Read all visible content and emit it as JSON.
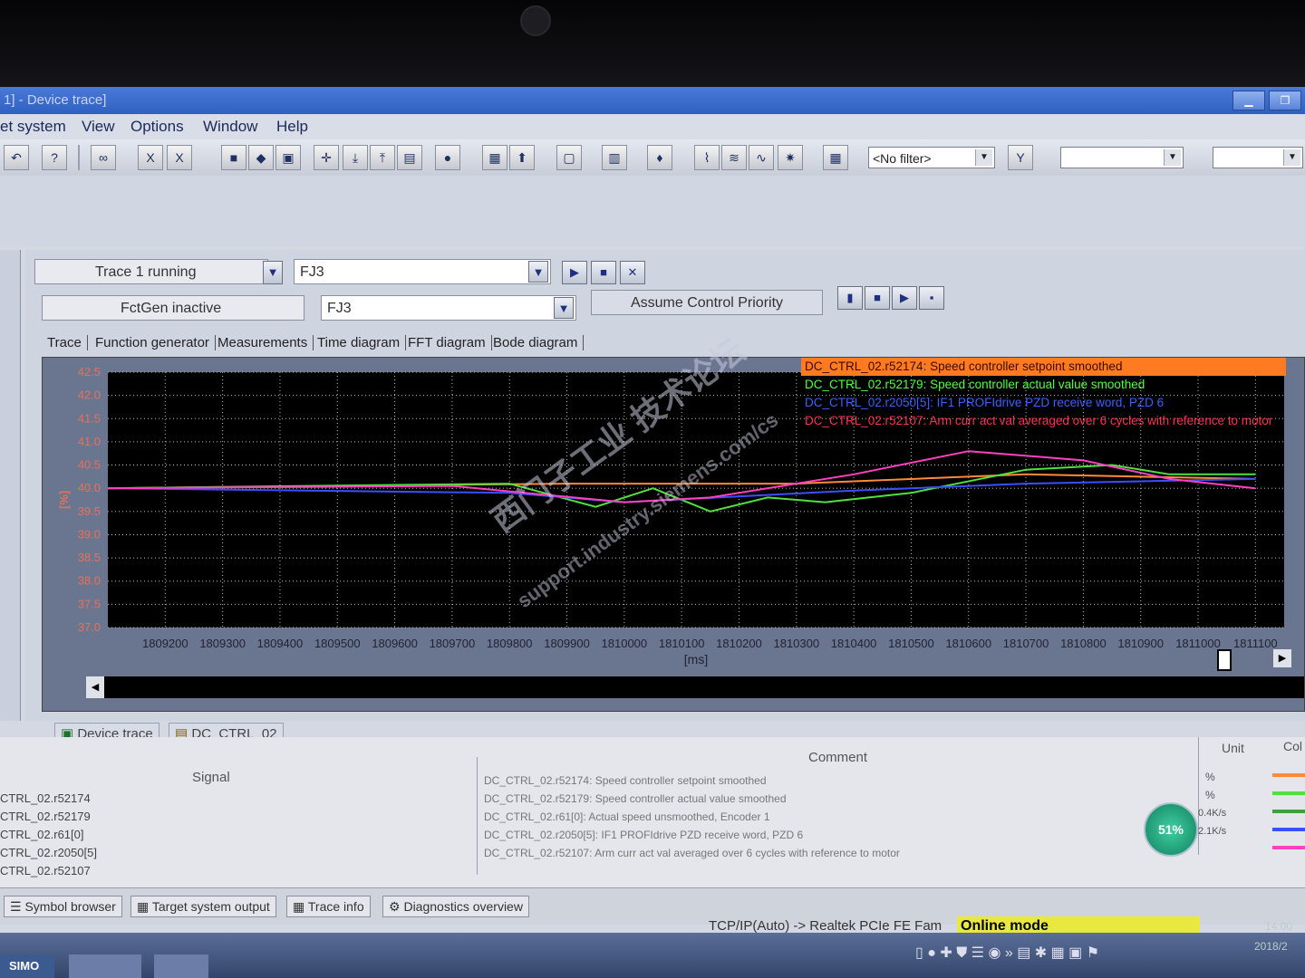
{
  "window": {
    "title": "1] - Device trace]",
    "min": "▁",
    "max": "❐"
  },
  "menu": [
    "et system",
    "View",
    "Options",
    "Window",
    "Help"
  ],
  "toolbar": {
    "filter_value": "<No filter>"
  },
  "trace_controls": {
    "trace_status": "Trace 1 running",
    "trace_drive": "FJ3",
    "fctgen_status": "FctGen  inactive",
    "fctgen_drive": "FJ3",
    "assume_priority": "Assume Control Priority"
  },
  "tabs": [
    "Trace",
    "Function generator",
    "Measurements",
    "Time diagram",
    "FFT diagram",
    "Bode diagram"
  ],
  "chart_data": {
    "type": "line",
    "ylabel": "[%]",
    "xlabel": "[ms]",
    "yticks": [
      "42.5",
      "42.0",
      "41.5",
      "41.0",
      "40.5",
      "40.0",
      "39.5",
      "39.0",
      "38.5",
      "38.0",
      "37.5",
      "37.0"
    ],
    "xticks": [
      "1809200",
      "1809300",
      "1809400",
      "1809500",
      "1809600",
      "1809700",
      "1809800",
      "1809900",
      "1810000",
      "1810100",
      "1810200",
      "1810300",
      "1810400",
      "1810500",
      "1810600",
      "1810700",
      "1810800",
      "1810900",
      "1811000",
      "1811100"
    ],
    "ylim": [
      37.0,
      42.5
    ],
    "series": [
      {
        "name": "DC_CTRL_02.r52174: Speed controller setpoint smoothed",
        "color": "#ff8a3a",
        "x": [
          1809100,
          1809500,
          1809900,
          1810300,
          1810700,
          1811100
        ],
        "y": [
          40.0,
          40.05,
          40.1,
          40.1,
          40.3,
          40.2
        ]
      },
      {
        "name": "DC_CTRL_02.r52179: Speed controller actual value smoothed",
        "color": "#50e040",
        "x": [
          1809100,
          1809800,
          1809950,
          1810050,
          1810150,
          1810250,
          1810350,
          1810500,
          1810700,
          1810850,
          1810950,
          1811100
        ],
        "y": [
          40.0,
          40.1,
          39.6,
          40.0,
          39.5,
          39.8,
          39.7,
          39.9,
          40.4,
          40.5,
          40.3,
          40.3
        ]
      },
      {
        "name": "DC_CTRL_02.r2050[5]: IF1 PROFIdrive PZD receive word, PZD 6",
        "color": "#3a50ff",
        "x": [
          1809100,
          1809800,
          1810000,
          1810400,
          1810700,
          1811100
        ],
        "y": [
          40.0,
          39.9,
          39.7,
          39.95,
          40.1,
          40.2
        ]
      },
      {
        "name": "DC_CTRL_02.r52107: Arm curr act val averaged over 6 cycles with reference to motor",
        "color": "#ff40c0",
        "x": [
          1809100,
          1809700,
          1810000,
          1810150,
          1810400,
          1810600,
          1810800,
          1810950,
          1811100
        ],
        "y": [
          40.0,
          40.05,
          39.7,
          39.8,
          40.3,
          40.8,
          40.6,
          40.2,
          40.0
        ]
      }
    ]
  },
  "bottom_tabs": [
    "Device trace",
    "DC_CTRL_02"
  ],
  "signal_table": {
    "headers": {
      "signal": "Signal",
      "comment": "Comment",
      "unit": "Unit",
      "color": "Col"
    },
    "rows": [
      {
        "signal": "CTRL_02.r52174",
        "comment": "DC_CTRL_02.r52174: Speed controller setpoint smoothed",
        "unit": "%"
      },
      {
        "signal": "CTRL_02.r52179",
        "comment": "DC_CTRL_02.r52179: Speed controller actual value smoothed",
        "unit": "%"
      },
      {
        "signal": "CTRL_02.r61[0]",
        "comment": "DC_CTRL_02.r61[0]: Actual speed unsmoothed, Encoder 1",
        "unit": ""
      },
      {
        "signal": "CTRL_02.r2050[5]",
        "comment": "DC_CTRL_02.r2050[5]: IF1 PROFIdrive PZD receive word, PZD 6",
        "unit": ""
      },
      {
        "signal": "CTRL_02.r52107",
        "comment": "DC_CTRL_02.r52107: Arm curr act val averaged over 6 cycles with reference to motor",
        "unit": ""
      }
    ]
  },
  "status_tabs": [
    "Symbol browser",
    "Target system output",
    "Trace info",
    "Diagnostics overview"
  ],
  "connection": "TCP/IP(Auto) -> Realtek PCIe FE Fam",
  "online_mode": "Online mode",
  "network": {
    "percent": "51%",
    "up": "0.4K/s",
    "down": "2.1K/s"
  },
  "clock": {
    "time": "14:00",
    "date": "2018/2"
  },
  "watermark": {
    "cn": "西门子工业 技术论坛",
    "url": "support.industry.siemens.com/cs"
  }
}
